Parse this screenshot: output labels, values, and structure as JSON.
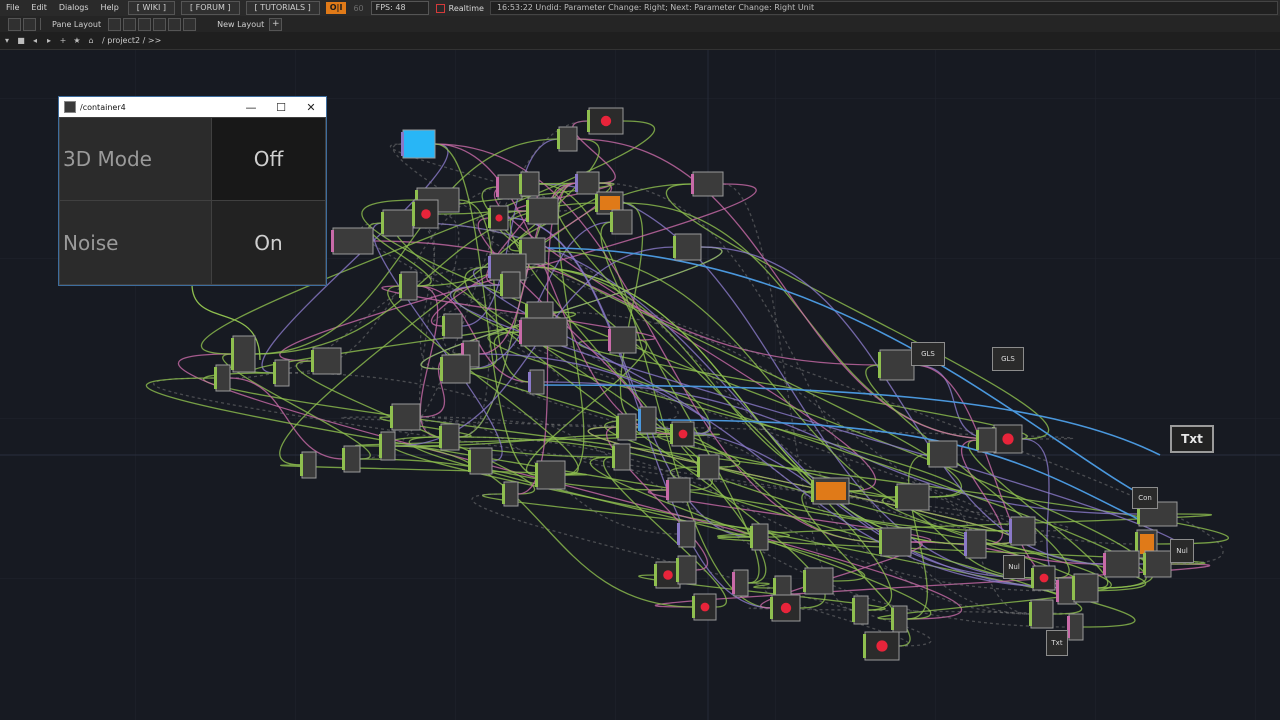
{
  "menu": {
    "items": [
      "File",
      "Edit",
      "Dialogs",
      "Help"
    ],
    "wiki": "[ WIKI ]",
    "forum": "[ FORUM ]",
    "tutorials": "[ TUTORIALS ]",
    "oi": "O|I",
    "sixty": "60",
    "fps": "FPS: 48",
    "realtime": "Realtime",
    "status": "16:53:22 Undid: Parameter Change: Right; Next: Parameter Change: Right Unit"
  },
  "panebar": {
    "pane_layout": "Pane Layout",
    "new_layout": "New Layout"
  },
  "pathbar": {
    "path": "/ project2 / >>"
  },
  "window": {
    "title": "/container4",
    "cells": [
      {
        "label": "3D Mode",
        "value": "Off"
      },
      {
        "label": "Noise",
        "value": "On"
      }
    ]
  },
  "ops": {
    "txt": "Txt",
    "gls_a": "GLS",
    "gls_b": "GLS",
    "con": "Con",
    "nul": "Nul",
    "txt_small": "Txt",
    "null_small": "Nul"
  },
  "colors": {
    "green_wire": "#8fbf4f",
    "pink_wire": "#c86aa8",
    "purple_wire": "#8a79c8",
    "blue_wire": "#4a97dc",
    "grey_wire": "#8a8a8a",
    "orange_accent": "#e07a18"
  }
}
